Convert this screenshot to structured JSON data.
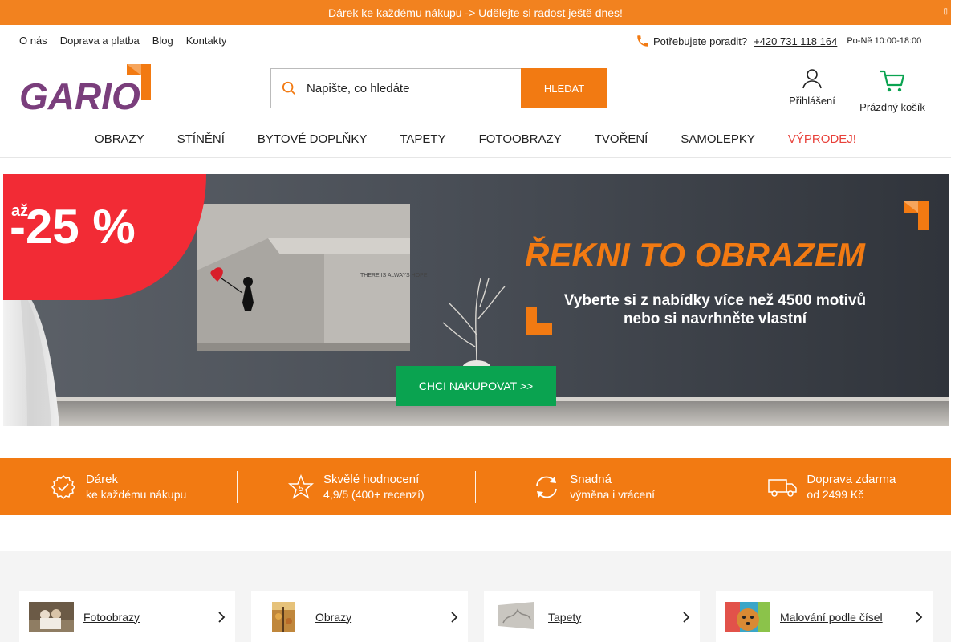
{
  "topbar": {
    "message": "Dárek ke každému nákupu -> Udělejte si radost ještě dnes!",
    "close": "▯"
  },
  "infobar": {
    "links": [
      "O nás",
      "Doprava a platba",
      "Blog",
      "Kontakty"
    ],
    "help_text": "Potřebujete poradit?",
    "phone": "+420 731 118 164",
    "hours": "Po-Ně 10:00-18:00"
  },
  "logo": {
    "text": "GARIO"
  },
  "search": {
    "placeholder": "Napište, co hledáte",
    "button": "HLEDAT"
  },
  "account": {
    "label": "Přihlášení"
  },
  "cart": {
    "label": "Prázdný košík"
  },
  "nav": {
    "items": [
      "OBRAZY",
      "STÍNĚNÍ",
      "BYTOVÉ DOPLŇKY",
      "TAPETY",
      "FOTOOBRAZY",
      "TVOŘENÍ",
      "SAMOLEPKY",
      "VÝPRODEJ!"
    ]
  },
  "hero": {
    "badge_small": "až",
    "badge_big": "-25 %",
    "headline": "ŘEKNI TO OBRAZEM",
    "sub1": "Vyberte si z nabídky více než 4500 motivů",
    "sub2": "nebo si navrhněte vlastní",
    "painting_text": "THERE IS ALWAYS HOPE",
    "cta": "CHCI NAKUPOVAT >>"
  },
  "benefits": [
    {
      "title": "Dárek",
      "text": "ke každému nákupu"
    },
    {
      "title": "Skvělé hodnocení",
      "text": "4,9/5 (400+ recenzí)"
    },
    {
      "title": "Snadná",
      "text": "výměna i vrácení"
    },
    {
      "title": "Doprava zdarma",
      "text": "od 2499 Kč"
    }
  ],
  "categories": [
    {
      "label": "Fotoobrazy"
    },
    {
      "label": "Obrazy"
    },
    {
      "label": "Tapety"
    },
    {
      "label": "Malování podle čísel"
    }
  ],
  "colors": {
    "accent": "#f27a12",
    "sale": "#e8413a",
    "cta": "#0aa350",
    "logo_purple": "#7a3e7c"
  }
}
